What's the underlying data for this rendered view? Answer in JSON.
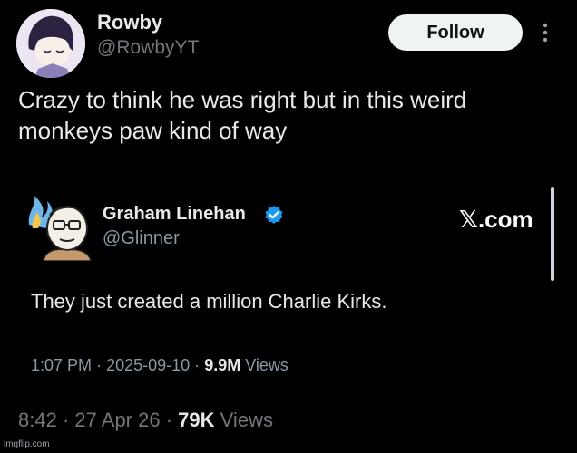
{
  "author": {
    "display_name": "Rowby",
    "handle": "@RowbyYT",
    "follow_label": "Follow",
    "more_icon": "more-vertical-icon"
  },
  "tweet": {
    "text": "Crazy to think he was right but in this weird monkeys paw kind of way"
  },
  "quoted": {
    "display_name": "Graham Linehan",
    "handle": "@Glinner",
    "verified": true,
    "verified_color": "#1d9bf0",
    "source_logo_text": ".com",
    "source_logo_glyph": "𝕏",
    "text": "They just created a million Charlie Kirks.",
    "time": "1:07 PM",
    "date": "2025-09-10",
    "views_count": "9.9M",
    "views_label": "Views",
    "separator": "·"
  },
  "footer": {
    "time": "8:42",
    "date": "27 Apr 26",
    "views_count": "79K",
    "views_label": "Views",
    "separator": "·"
  },
  "watermark": "imgflip.com",
  "colors": {
    "background": "#000000",
    "primary_text": "#e7e9ea",
    "secondary_text": "#71767b",
    "follow_button_bg": "#eff3f4"
  }
}
